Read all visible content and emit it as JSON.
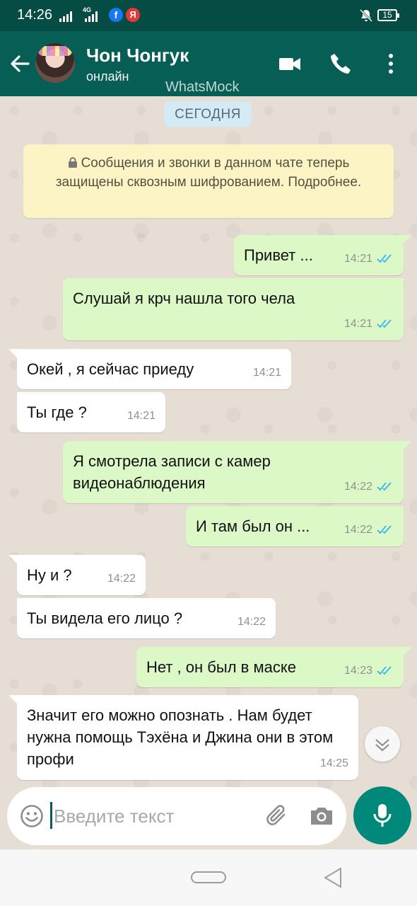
{
  "status_bar": {
    "time": "14:26",
    "network": "4G",
    "battery": "15"
  },
  "header": {
    "contact_name": "Чон Чонгук",
    "contact_status": "онлайн"
  },
  "watermark": "WhatsMock",
  "chat": {
    "date_label": "СЕГОДНЯ",
    "encryption_notice": "Сообщения и звонки в данном чате теперь защищены сквозным шифрованием. Подробнее.",
    "messages": [
      {
        "direction": "out",
        "text": "Привет ...",
        "time": "14:21",
        "status": "read"
      },
      {
        "direction": "out",
        "text": "Слушай я крч нашла того чела",
        "time": "14:21",
        "status": "read"
      },
      {
        "direction": "in",
        "text": "Окей , я сейчас приеду",
        "time": "14:21"
      },
      {
        "direction": "in",
        "text": "Ты где ?",
        "time": "14:21"
      },
      {
        "direction": "out",
        "text": "Я смотрела записи с камер видеонаблюдения",
        "time": "14:22",
        "status": "read"
      },
      {
        "direction": "out",
        "text": "И там был он ...",
        "time": "14:22",
        "status": "read"
      },
      {
        "direction": "in",
        "text": "Ну и ?",
        "time": "14:22"
      },
      {
        "direction": "in",
        "text": "Ты видела его лицо ?",
        "time": "14:22"
      },
      {
        "direction": "out",
        "text": "Нет , он был в маске",
        "time": "14:23",
        "status": "read"
      },
      {
        "direction": "in",
        "text": "Значит его можно опознать . Нам будет нужна помощь Тэхёна и Джина они в этом профи",
        "time": "14:25"
      }
    ]
  },
  "composer": {
    "placeholder": "Введите текст",
    "value": ""
  },
  "colors": {
    "header": "#075e54",
    "status_bar": "#054d44",
    "outgoing_bubble": "#dcf8c6",
    "incoming_bubble": "#ffffff",
    "read_tick": "#34b7f1",
    "mic_button": "#00897b"
  },
  "icons": [
    "back-arrow-icon",
    "video-call-icon",
    "phone-icon",
    "more-options-icon",
    "lock-icon",
    "double-check-icon",
    "chevron-down-icon",
    "emoji-icon",
    "paperclip-icon",
    "camera-icon",
    "microphone-icon"
  ]
}
